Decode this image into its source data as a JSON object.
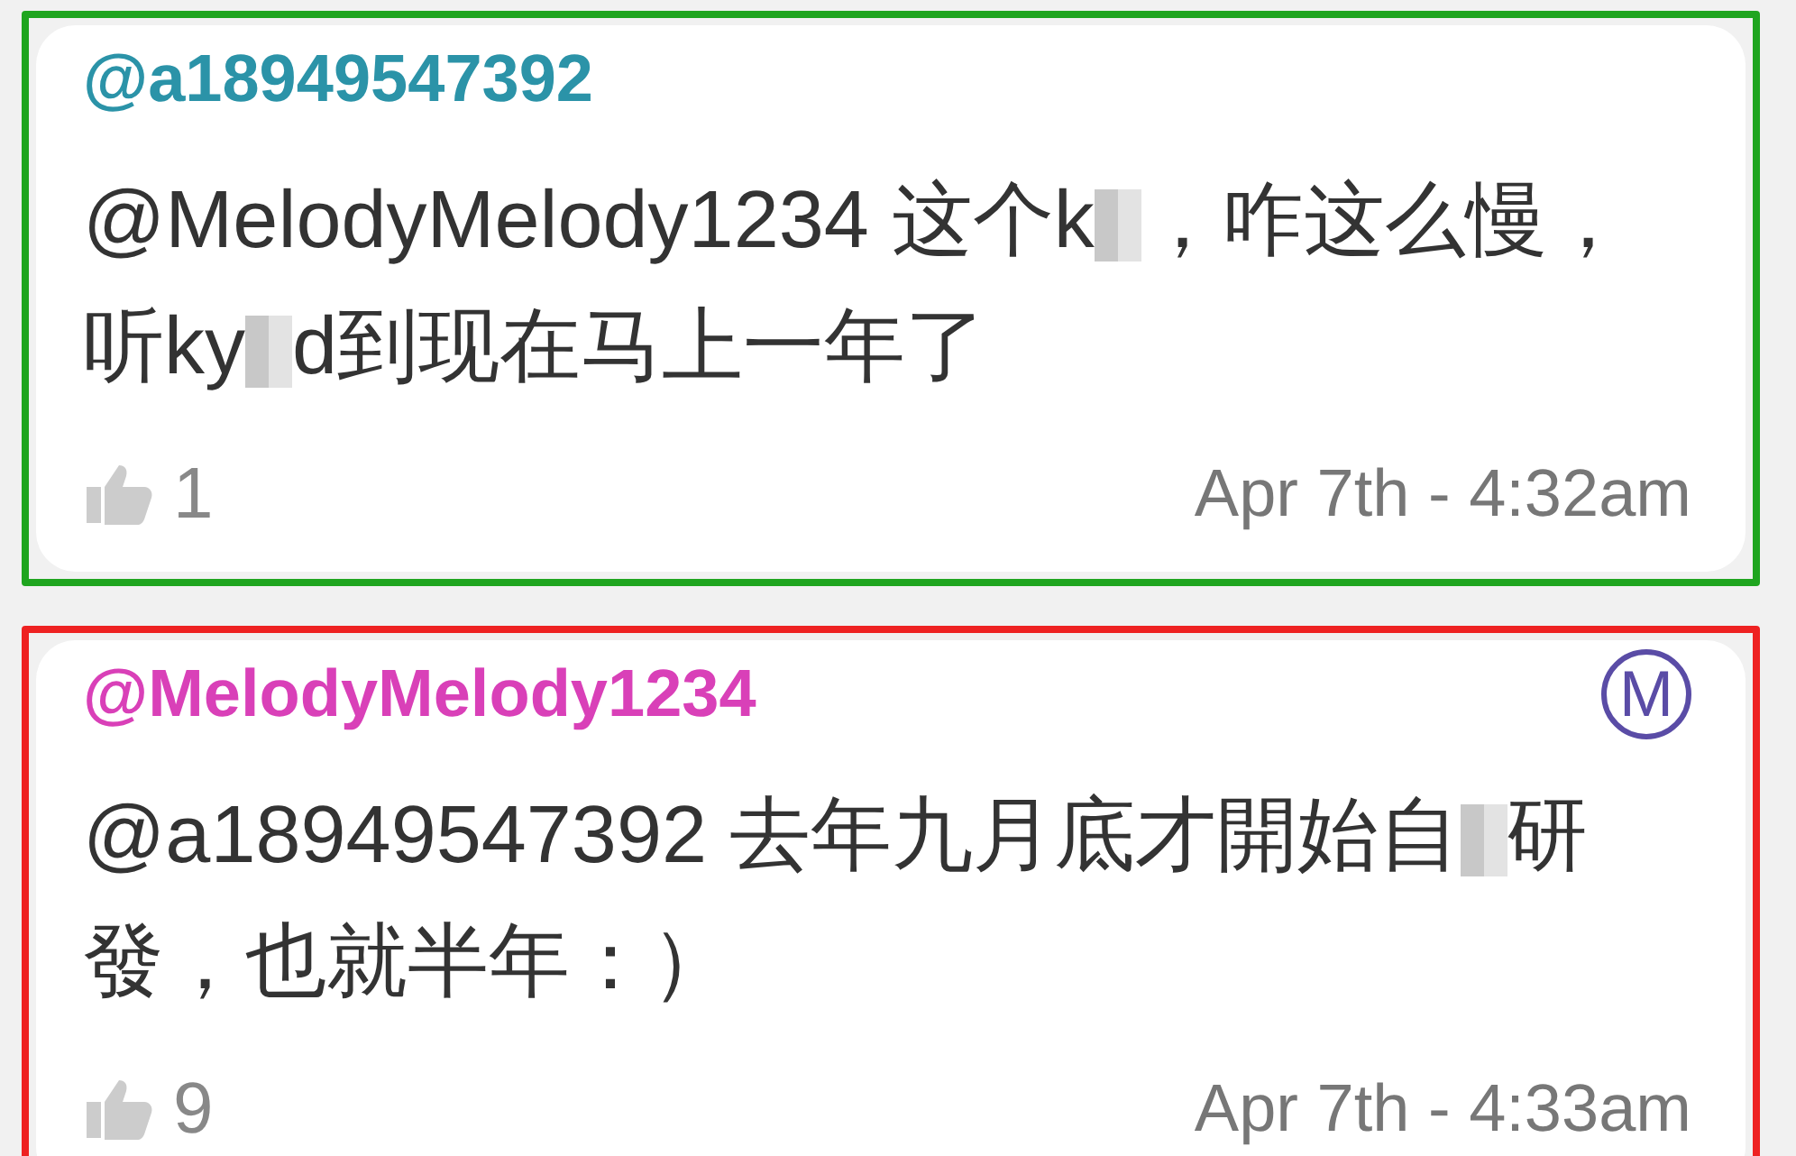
{
  "comments": [
    {
      "author": "@a18949547392",
      "color": "#2b93a8",
      "highlight": {
        "color": "#1fa51f"
      },
      "segments": [
        {
          "kind": "text",
          "text": "@MelodyMelody1234 这个k"
        },
        {
          "kind": "redacted"
        },
        {
          "kind": "text",
          "text": "，咋这么慢，听ky"
        },
        {
          "kind": "redacted"
        },
        {
          "kind": "text",
          "text": "d到现在马上一年了"
        }
      ],
      "likes": "1",
      "time": "Apr 7th - 4:32am"
    },
    {
      "author": "@MelodyMelody1234",
      "color": "#d940b8",
      "highlight": {
        "color": "#ee2222"
      },
      "badge": "M",
      "segments": [
        {
          "kind": "text",
          "text": "@a18949547392 去年九月底才開始自"
        },
        {
          "kind": "redacted"
        },
        {
          "kind": "text",
          "text": "研發，也就半年：）"
        }
      ],
      "likes": "9",
      "time": "Apr 7th - 4:33am"
    }
  ]
}
